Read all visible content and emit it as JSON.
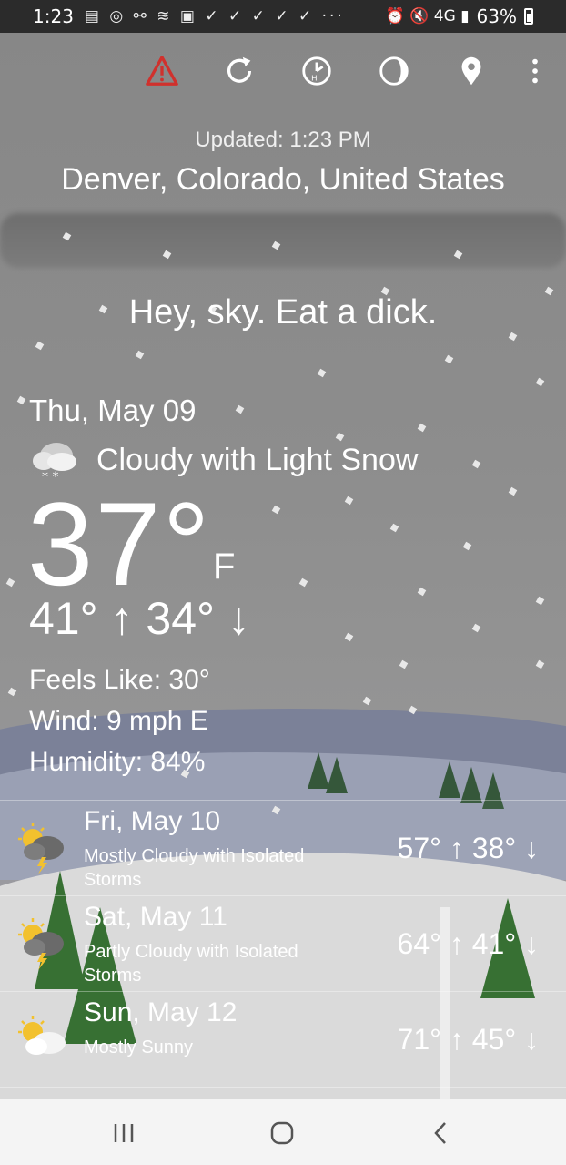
{
  "status_bar": {
    "time": "1:23",
    "notification_glyphs": "▤ ◎ ⚯ ≋ ▣ ✓ ✓ ✓ ✓ ✓ ···",
    "right_glyphs": "⏰ 🔇 4G ▮",
    "battery": "63%"
  },
  "toolbar": {
    "icons": [
      "alert-icon",
      "refresh-icon",
      "hourly-clock-icon",
      "moon-phase-icon",
      "location-pin-icon",
      "more-vert-icon"
    ],
    "alert_color": "#d0312d"
  },
  "header": {
    "updated": "Updated: 1:23 PM",
    "location": "Denver, Colorado, United States",
    "tagline": "Hey, sky. Eat a dick."
  },
  "current": {
    "date": "Thu, May 09",
    "condition": "Cloudy with Light Snow",
    "condition_icon": "cloud-snow-icon",
    "temperature": "37°",
    "unit": "F",
    "high_low": "41° ↑ 34° ↓",
    "feels_like": "Feels Like: 30°",
    "wind": "Wind: 9 mph E",
    "humidity": "Humidity: 84%"
  },
  "forecast": [
    {
      "date": "Fri, May 10",
      "desc": "Mostly Cloudy with Isolated Storms",
      "temps": "57° ↑ 38° ↓",
      "icon": "sun-cloud-storm-icon"
    },
    {
      "date": "Sat, May 11",
      "desc": "Partly Cloudy with Isolated Storms",
      "temps": "64° ↑ 41° ↓",
      "icon": "sun-cloud-storm-icon"
    },
    {
      "date": "Sun, May 12",
      "desc": "Mostly Sunny",
      "temps": "71° ↑ 45° ↓",
      "icon": "sun-cloud-icon"
    }
  ],
  "nav": {
    "recent": "|||",
    "home": "○",
    "back": "‹"
  }
}
